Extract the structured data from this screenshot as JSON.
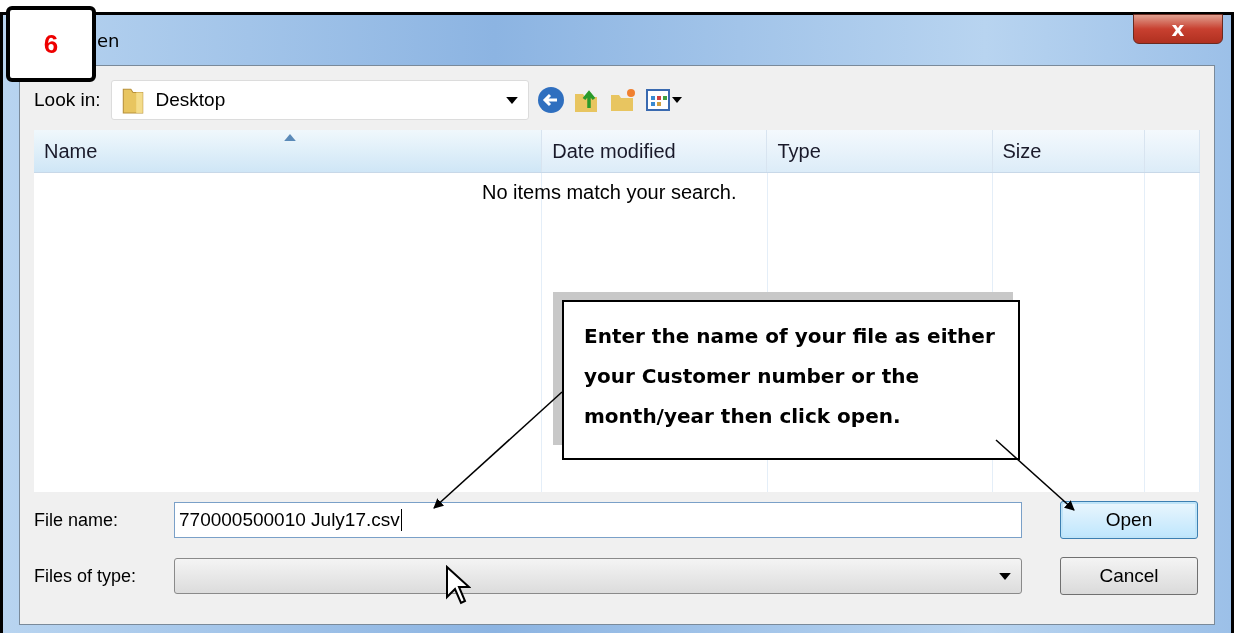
{
  "step_badge": "6",
  "window": {
    "title": "en",
    "close": "x"
  },
  "look_in": {
    "label": "Look in:",
    "value": "Desktop"
  },
  "table": {
    "columns": [
      {
        "label": "Name",
        "sorted": true
      },
      {
        "label": "Date modified",
        "sorted": false
      },
      {
        "label": "Type",
        "sorted": false
      },
      {
        "label": "Size",
        "sorted": false
      }
    ],
    "empty_message": "No items match your search."
  },
  "callout": "Enter the name of your file as either your Customer number or the month/year then click open.",
  "file_name": {
    "label": "File name:",
    "value": "770000500010 July17.csv"
  },
  "file_type": {
    "label": "Files of type:"
  },
  "buttons": [
    {
      "label": "Open",
      "default": true
    },
    {
      "label": "Cancel",
      "default": false
    }
  ]
}
